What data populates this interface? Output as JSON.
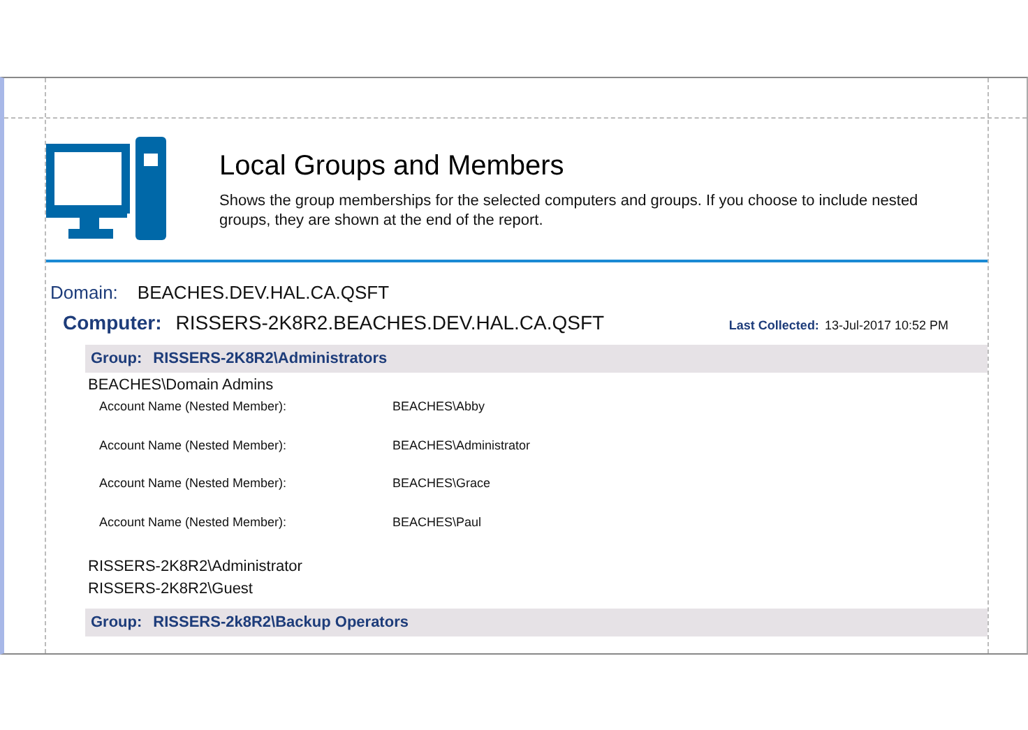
{
  "report": {
    "title": "Local Groups and Members",
    "description": "Shows the group memberships for the selected computers and groups. If you choose to include nested groups, they are shown at the end of the report."
  },
  "domain": {
    "label": "Domain:",
    "value": "BEACHES.DEV.HAL.CA.QSFT"
  },
  "computer": {
    "label": "Computer:",
    "value": "RISSERS-2K8R2.BEACHES.DEV.HAL.CA.QSFT",
    "last_collected_label": "Last Collected:",
    "last_collected_value": "13-Jul-2017 10:52 PM"
  },
  "groups": [
    {
      "label": "Group:",
      "name": "RISSERS-2K8R2\\Administrators",
      "members": [
        {
          "name": "BEACHES\\Domain Admins",
          "nested": [
            {
              "label": "Account Name (Nested Member):",
              "value": "BEACHES\\Abby"
            },
            {
              "label": "Account Name (Nested Member):",
              "value": "BEACHES\\Administrator"
            },
            {
              "label": "Account Name (Nested Member):",
              "value": "BEACHES\\Grace"
            },
            {
              "label": "Account Name (Nested Member):",
              "value": "BEACHES\\Paul"
            }
          ]
        },
        {
          "name": "RISSERS-2K8R2\\Administrator"
        },
        {
          "name": "RISSERS-2K8R2\\Guest"
        }
      ]
    },
    {
      "label": "Group:",
      "name": "RISSERS-2k8R2\\Backup Operators"
    }
  ]
}
